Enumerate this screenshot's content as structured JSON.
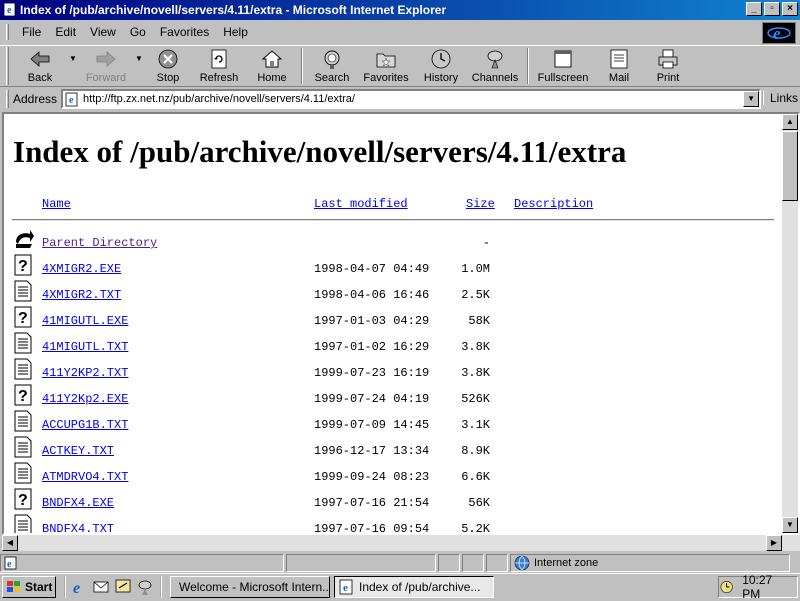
{
  "window": {
    "title": "Index of /pub/archive/novell/servers/4.11/extra - Microsoft Internet Explorer",
    "minimize": "_",
    "maximize": "▫",
    "close": "×"
  },
  "menu": [
    "File",
    "Edit",
    "View",
    "Go",
    "Favorites",
    "Help"
  ],
  "toolbar": {
    "back": "Back",
    "forward": "Forward",
    "stop": "Stop",
    "refresh": "Refresh",
    "home": "Home",
    "search": "Search",
    "favorites": "Favorites",
    "history": "History",
    "channels": "Channels",
    "fullscreen": "Fullscreen",
    "mail": "Mail",
    "print": "Print"
  },
  "address": {
    "label": "Address",
    "url": "http://ftp.zx.net.nz/pub/archive/novell/servers/4.11/extra/",
    "links": "Links"
  },
  "page": {
    "heading": "Index of /pub/archive/novell/servers/4.11/extra",
    "columns": {
      "name": "Name",
      "modified": "Last modified",
      "size": "Size",
      "description": "Description"
    },
    "parent": {
      "name": "Parent Directory",
      "size": "-"
    },
    "files": [
      {
        "icon": "unknown",
        "name": "4XMIGR2.EXE",
        "date": "1998-04-07 04:49",
        "size": "1.0M"
      },
      {
        "icon": "text",
        "name": "4XMIGR2.TXT",
        "date": "1998-04-06 16:46",
        "size": "2.5K"
      },
      {
        "icon": "unknown",
        "name": "41MIGUTL.EXE",
        "date": "1997-01-03 04:29",
        "size": "58K"
      },
      {
        "icon": "text",
        "name": "41MIGUTL.TXT",
        "date": "1997-01-02 16:29",
        "size": "3.8K"
      },
      {
        "icon": "text",
        "name": "411Y2KP2.TXT",
        "date": "1999-07-23 16:19",
        "size": "3.8K"
      },
      {
        "icon": "unknown",
        "name": "411Y2Kp2.EXE",
        "date": "1999-07-24 04:19",
        "size": "526K"
      },
      {
        "icon": "text",
        "name": "ACCUPG1B.TXT",
        "date": "1999-07-09 14:45",
        "size": "3.1K"
      },
      {
        "icon": "text",
        "name": "ACTKEY.TXT",
        "date": "1996-12-17 13:34",
        "size": "8.9K"
      },
      {
        "icon": "text",
        "name": "ATMDRVO4.TXT",
        "date": "1999-09-24 08:23",
        "size": "6.6K"
      },
      {
        "icon": "unknown",
        "name": "BNDFX4.EXE",
        "date": "1997-07-16 21:54",
        "size": "56K"
      },
      {
        "icon": "text",
        "name": "BNDFX4.TXT",
        "date": "1997-07-16 09:54",
        "size": "5.2K"
      }
    ]
  },
  "status": {
    "zone": "Internet zone"
  },
  "taskbar": {
    "start": "Start",
    "tasks": [
      {
        "label": "Welcome - Microsoft Intern...",
        "active": false
      },
      {
        "label": "Index of /pub/archive...",
        "active": true
      }
    ],
    "clock": "10:27 PM"
  }
}
